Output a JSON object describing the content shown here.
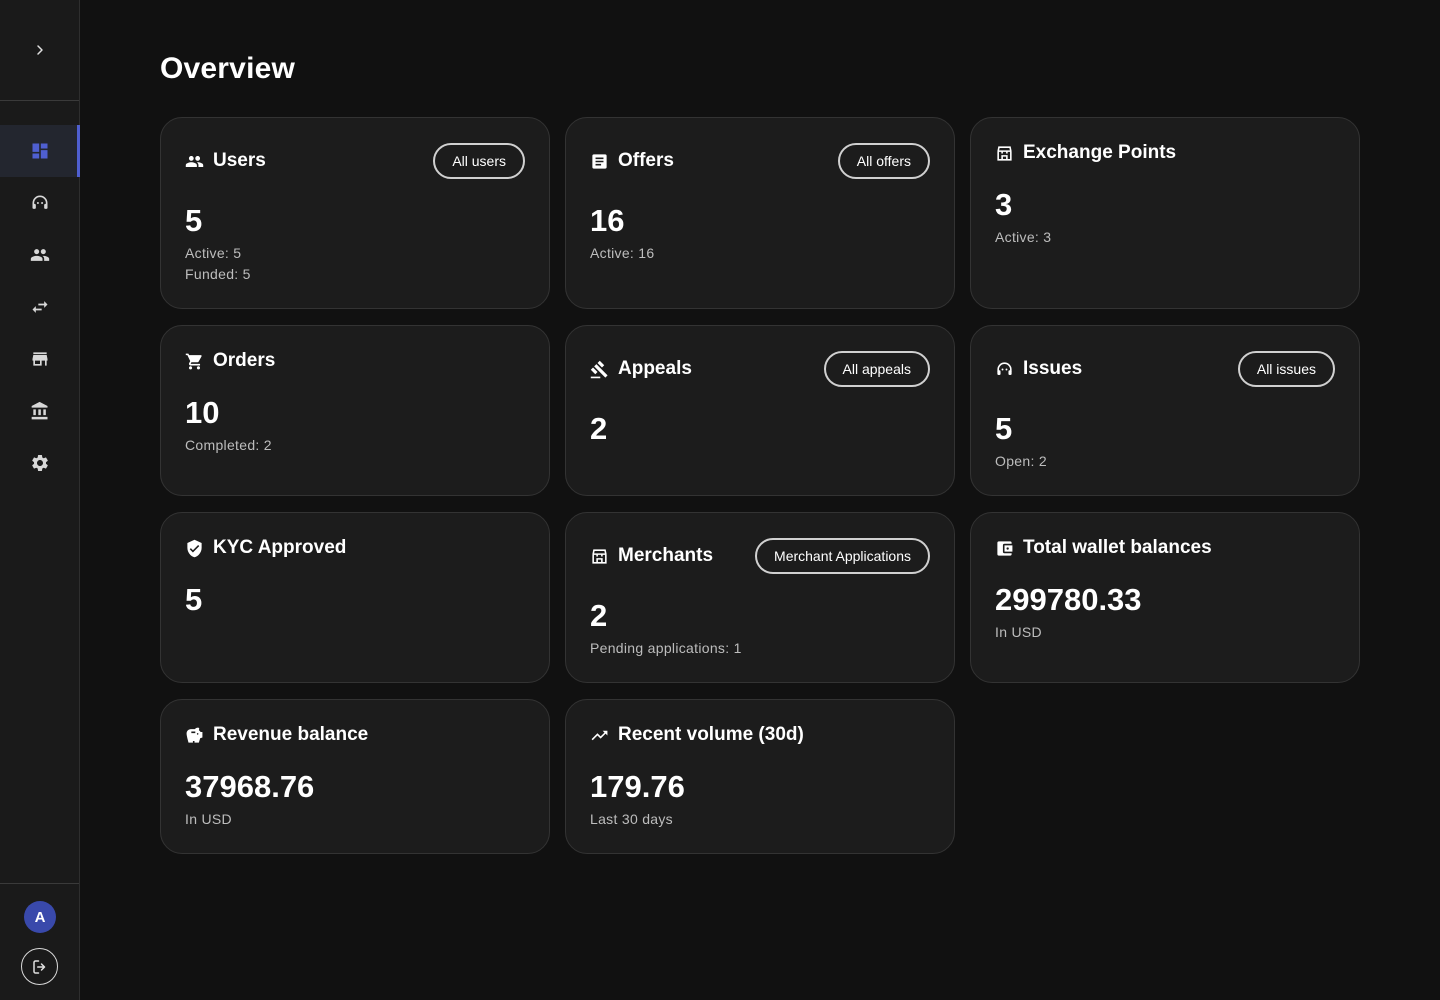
{
  "page": {
    "title": "Overview"
  },
  "sidebar": {
    "nav": [
      {
        "icon": "dashboard-icon",
        "active": true
      },
      {
        "icon": "support-agent-icon",
        "active": false
      },
      {
        "icon": "users-icon",
        "active": false
      },
      {
        "icon": "swap-arrows-icon",
        "active": false
      },
      {
        "icon": "store-icon",
        "active": false
      },
      {
        "icon": "bank-icon",
        "active": false
      },
      {
        "icon": "gear-icon",
        "active": false
      }
    ],
    "avatar_letter": "A",
    "accent_color": "#4f5fd0"
  },
  "cards": {
    "users": {
      "title": "Users",
      "button": "All users",
      "value": "5",
      "sub1": "Active: 5",
      "sub2": "Funded: 5"
    },
    "offers": {
      "title": "Offers",
      "button": "All offers",
      "value": "16",
      "sub1": "Active: 16"
    },
    "exchange_points": {
      "title": "Exchange Points",
      "value": "3",
      "sub1": "Active: 3"
    },
    "orders": {
      "title": "Orders",
      "value": "10",
      "sub1": "Completed: 2"
    },
    "appeals": {
      "title": "Appeals",
      "button": "All appeals",
      "value": "2"
    },
    "issues": {
      "title": "Issues",
      "button": "All issues",
      "value": "5",
      "sub1": "Open: 2"
    },
    "kyc": {
      "title": "KYC Approved",
      "value": "5"
    },
    "merchants": {
      "title": "Merchants",
      "button": "Merchant Applications",
      "value": "2",
      "sub1": "Pending applications: 1"
    },
    "wallet": {
      "title": "Total wallet balances",
      "value": "299780.33",
      "sub1": "In USD"
    },
    "revenue": {
      "title": "Revenue balance",
      "value": "37968.76",
      "sub1": "In USD"
    },
    "volume": {
      "title": "Recent volume (30d)",
      "value": "179.76",
      "sub1": "Last 30 days"
    }
  }
}
